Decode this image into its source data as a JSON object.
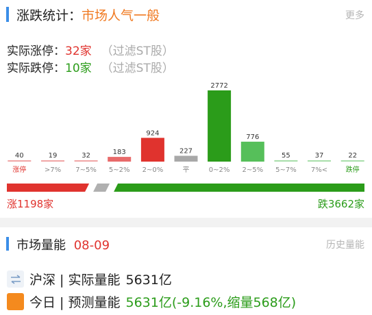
{
  "header": {
    "title_prefix": "涨跌统计：",
    "title_accent": "市场人气一般",
    "more_label": "更多"
  },
  "limit_up": {
    "label": "实际涨停：",
    "value": "32家",
    "note": "（过滤ST股）"
  },
  "limit_down": {
    "label": "实际跌停：",
    "value": "10家",
    "note": "（过滤ST股）"
  },
  "chart_data": {
    "type": "bar",
    "categories": [
      "涨停",
      ">7%",
      "7~5%",
      "5~2%",
      "2~0%",
      "平",
      "0~2%",
      "2~5%",
      "5~7%",
      "7%<",
      "跌停"
    ],
    "values": [
      40,
      19,
      32,
      183,
      924,
      227,
      2772,
      776,
      55,
      37,
      22
    ],
    "colors": [
      "#f0a5a5",
      "#f0a5a5",
      "#f0a5a5",
      "#e86a6a",
      "#e0332e",
      "#a8a8a8",
      "#2b9c1a",
      "#56bf5a",
      "#a8deaa",
      "#a8deaa",
      "#a8deaa"
    ],
    "label_colors": [
      "#e0332e",
      "#888888",
      "#888888",
      "#888888",
      "#888888",
      "#888888",
      "#888888",
      "#888888",
      "#888888",
      "#888888",
      "#2b9c1a"
    ],
    "ylim": [
      0,
      2772
    ]
  },
  "ratio": {
    "up_label": "涨1198家",
    "down_label": "跌3662家",
    "up_count": 1198,
    "flat_count": 227,
    "down_count": 3662,
    "up_color": "#e0332e",
    "flat_color": "#b0b0b0",
    "down_color": "#2b9c1a"
  },
  "volume": {
    "title": "市场量能",
    "date": "08-09",
    "history_label": "历史量能",
    "rows": [
      {
        "icon": "swap-arrows-icon",
        "label": "沪深 | 实际量能",
        "value": "5631亿",
        "value_color": "#222222"
      },
      {
        "icon": "orange-square-icon",
        "label": "今日 | 预测量能",
        "value": "5631亿(-9.16%,缩量568亿)",
        "value_color": "#2b9c1a"
      }
    ]
  }
}
